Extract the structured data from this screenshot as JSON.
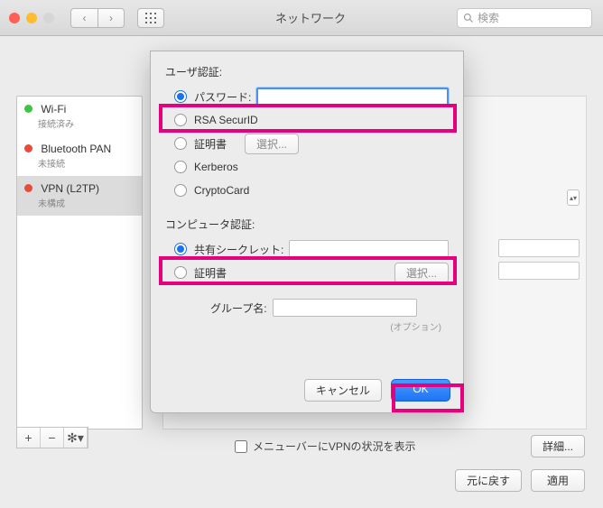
{
  "window": {
    "title": "ネットワーク",
    "search_placeholder": "検索"
  },
  "sidebar": {
    "items": [
      {
        "name": "Wi-Fi",
        "status": "接続済み",
        "dot": "green"
      },
      {
        "name": "Bluetooth PAN",
        "status": "未接続",
        "dot": "red"
      },
      {
        "name": "VPN (L2TP)",
        "status": "未構成",
        "dot": "red",
        "selected": true
      }
    ]
  },
  "sheet": {
    "user_auth_label": "ユーザ認証:",
    "user_auth_options": {
      "password": "パスワード:",
      "rsa": "RSA SecurID",
      "cert": "証明書",
      "kerberos": "Kerberos",
      "cryptocard": "CryptoCard"
    },
    "select_btn": "選択...",
    "machine_auth_label": "コンピュータ認証:",
    "machine_auth_options": {
      "shared_secret": "共有シークレット:",
      "cert": "証明書"
    },
    "select_btn2": "選択...",
    "group_label": "グループ名:",
    "option_note": "(オプション)",
    "cancel": "キャンセル",
    "ok": "OK"
  },
  "main": {
    "menubar_checkbox_label": "メニューバーにVPNの状況を表示",
    "details": "詳細...",
    "revert": "元に戻す",
    "apply": "適用"
  }
}
